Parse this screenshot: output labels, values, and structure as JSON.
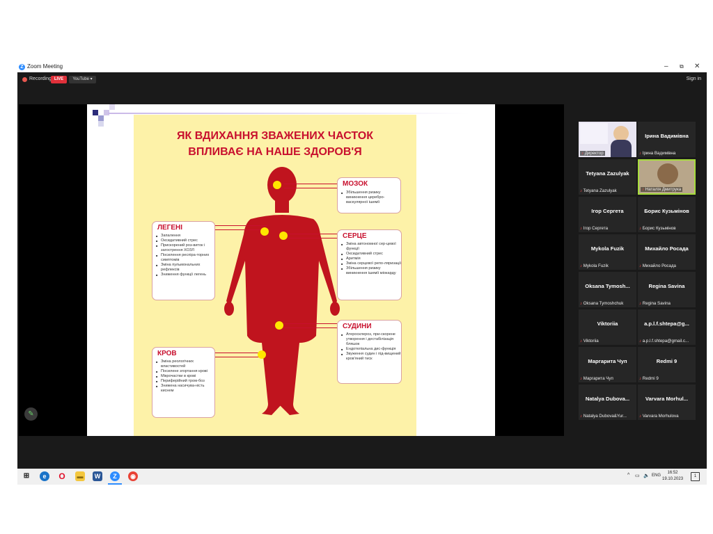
{
  "window": {
    "title": "Zoom Meeting",
    "min": "–",
    "max": "⧉",
    "close": "✕"
  },
  "topbar": {
    "recording": "Recording",
    "live": "LIVE",
    "youtube": "YouTube ▾",
    "signin": "Sign in"
  },
  "slide": {
    "title_line1": "ЯК ВДИХАННЯ ЗВАЖЕНИХ ЧАСТОК",
    "title_line2": "ВПЛИВАЄ НА НАШЕ ЗДОРОВ'Я",
    "brain": {
      "heading": "МОЗОК",
      "items": [
        "Збільшення ризику виникнення церебро-васкулярної ішемії"
      ]
    },
    "lungs": {
      "heading": "ЛЕГЕНІ",
      "items": [
        "Запалення",
        "Оксидативний стрес",
        "Прискорений роз-виток і загострення ХОЗЛ",
        "Посилення респіра-торних симптомів",
        "Зміна пульмональних рефлексів",
        "Зниження функції легень"
      ]
    },
    "heart": {
      "heading": "СЕРЦЕ",
      "items": [
        "Зміна автономної сер-цевої функції",
        "Оксидативний стрес",
        "Аритмія",
        "Зміна серцевої репо-ляризації",
        "Збільшення ризику виникнення ішемії міокарду"
      ]
    },
    "vessels": {
      "heading": "СУДИНИ",
      "items": [
        "Атеросклероз, при-скорене утворення і дестабілізація бляшок",
        "Ендотеліальна дис-функція",
        "Звуження судин і під-вищений кров'яний тиск"
      ]
    },
    "blood": {
      "heading": "КРОВ",
      "items": [
        "Зміна реологічних властивостей",
        "Посилене згортання крові",
        "Мікрочастки в крові",
        "Периферійний тром-боз",
        "Знижена насичува-ність киснем"
      ]
    }
  },
  "participants": [
    {
      "name": "",
      "label": "Директор",
      "video": true
    },
    {
      "name": "Ірина Вадимівна",
      "label": "Ірина Вадимівна",
      "video": false
    },
    {
      "name": "Tetyana Zazulyak",
      "label": "Tetyana Zazulyak",
      "video": false
    },
    {
      "name": "",
      "label": "Наталія Дмитрука",
      "video": true,
      "active": true
    },
    {
      "name": "Ігор Сергета",
      "label": "Ігор Сергета",
      "video": false
    },
    {
      "name": "Борис Кузьмінов",
      "label": "Борис Кузьмінов",
      "video": false
    },
    {
      "name": "Mykola Fuzik",
      "label": "Mykola Fuzik",
      "video": false
    },
    {
      "name": "Михайло Росада",
      "label": "Михайло Росада",
      "video": false
    },
    {
      "name": "Oksana Tymosh...",
      "label": "Oksana Tymoshchuk",
      "video": false
    },
    {
      "name": "Regina Savina",
      "label": "Regina Savina",
      "video": false
    },
    {
      "name": "Viktoriia",
      "label": "Viktoriia",
      "video": false
    },
    {
      "name": "a.p.l.f.shtepa@g...",
      "label": "a.p.l.f.shtepa@gmail.c...",
      "video": false
    },
    {
      "name": "Маргарита Чуп",
      "label": "Маргарита Чуп",
      "video": false
    },
    {
      "name": "Redmi 9",
      "label": "Redmi 9",
      "video": false
    },
    {
      "name": "Natalya Dubova...",
      "label": "Natalya Dubova&Yur...",
      "video": false
    },
    {
      "name": "Varvara Morhul...",
      "label": "Varvara Morhulova",
      "video": false
    }
  ],
  "taskbar": {
    "lang": "ENG",
    "time": "16:52",
    "date": "19.10.2023",
    "tray_arrow": "^"
  },
  "colors": {
    "accent_red": "#c8102e",
    "poster_bg": "#fdf2a8",
    "yellow_dot": "#ffe600",
    "zoom_blue": "#2d8cff",
    "active_border": "#a6dc3c"
  }
}
